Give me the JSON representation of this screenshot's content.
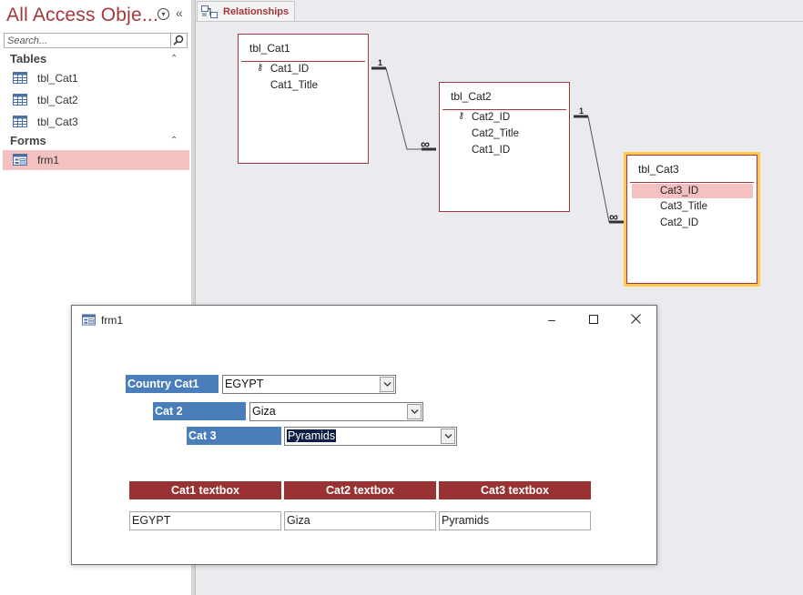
{
  "nav": {
    "title": "All Access Obje...",
    "search_placeholder": "Search...",
    "tables_header": "Tables",
    "tables": [
      "tbl_Cat1",
      "tbl_Cat2",
      "tbl_Cat3"
    ],
    "forms_header": "Forms",
    "forms": [
      "frm1"
    ],
    "icons": {
      "menu": "chevron-circle-down-icon",
      "collapse": "double-chevron-left-icon",
      "search": "search-icon"
    }
  },
  "tab": {
    "label": "Relationships",
    "icon": "relationships-icon"
  },
  "tables": [
    {
      "name": "tbl_Cat1",
      "fields": [
        "Cat1_ID",
        "Cat1_Title"
      ],
      "key": "Cat1_ID"
    },
    {
      "name": "tbl_Cat2",
      "fields": [
        "Cat2_ID",
        "Cat2_Title",
        "Cat1_ID"
      ],
      "key": "Cat2_ID"
    },
    {
      "name": "tbl_Cat3",
      "fields": [
        "Cat3_ID",
        "Cat3_Title",
        "Cat2_ID"
      ],
      "key": "Cat3_ID",
      "selected_field": "Cat3_ID"
    }
  ],
  "relationships": [
    {
      "one": "1",
      "many": "∞"
    },
    {
      "one": "1",
      "many": "∞"
    }
  ],
  "form": {
    "title": "frm1",
    "labels": [
      "Country Cat1",
      "Cat 2",
      "Cat 3"
    ],
    "combos": [
      "EGYPT",
      "Giza",
      "Pyramids"
    ],
    "headers": [
      "Cat1 textbox",
      "Cat2 textbox",
      "Cat3 textbox"
    ],
    "textboxes": [
      "EGYPT",
      "Giza",
      "Pyramids"
    ]
  },
  "colors": {
    "accent": "#a4373a",
    "label_blue": "#4a7ebb",
    "header_red": "#993333",
    "selection": "#f4c0c0",
    "active_outline": "#ffc94d"
  }
}
